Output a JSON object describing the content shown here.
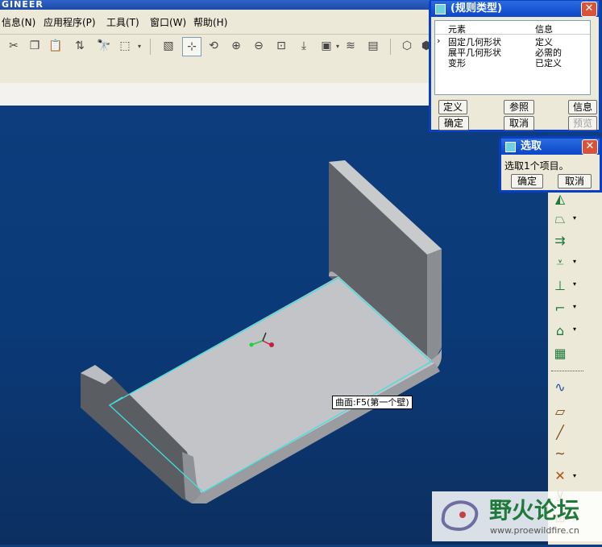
{
  "app": {
    "title_fragment": "GINEER"
  },
  "menu": [
    {
      "label": "信息(N)"
    },
    {
      "label": "应用程序(P)"
    },
    {
      "label": "工具(T)"
    },
    {
      "label": "窗口(W)"
    },
    {
      "label": "帮助(H)"
    }
  ],
  "rule_dialog": {
    "title": "(规则类型)",
    "columns": [
      "元素",
      "信息"
    ],
    "rows": [
      {
        "element": "固定几何形状",
        "info": "定义",
        "selected": true
      },
      {
        "element": "展平几何形状",
        "info": "必需的"
      },
      {
        "element": "变形",
        "info": "已定义"
      }
    ],
    "buttons": {
      "define": "定义",
      "refs": "参照",
      "info": "信息",
      "ok": "确定",
      "cancel": "取消",
      "preview": "预览"
    }
  },
  "select_dialog": {
    "title": "选取",
    "message": "选取1个项目。",
    "ok": "确定",
    "cancel": "取消"
  },
  "tooltip": "曲面:F5(第一个壁)",
  "watermark": {
    "text": "野火论坛",
    "url": "www.proewildfire.cn"
  },
  "colors": {
    "accent": "#0a3fc4",
    "viewport": "#0d3d7c",
    "edge_highlight": "#40e0e0"
  }
}
